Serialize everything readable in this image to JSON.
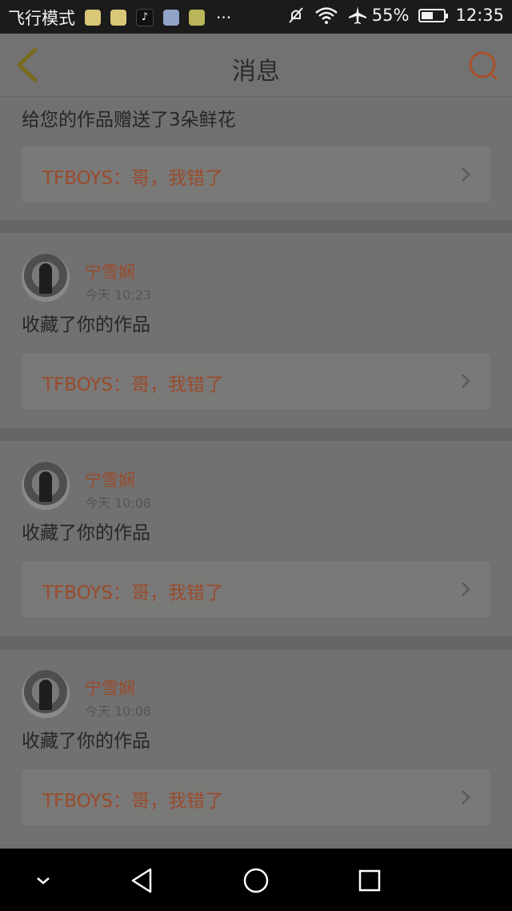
{
  "status_bar": {
    "mode": "飞行模式",
    "dots": "···",
    "battery": "55%",
    "battery_fraction": 0.55,
    "time": "12:35",
    "app_icons": [
      "qq-icon",
      "qq-icon",
      "tiktok-icon",
      "photo-app-icon",
      "medal-app-icon"
    ]
  },
  "header": {
    "title": "消息"
  },
  "feed": {
    "first_action": "给您的作品赠送了3朵鲜花",
    "work_title": "TFBOYS：哥，我错了",
    "items": [
      {
        "name": "宁雪娴",
        "time": "今天 10:23",
        "action": "收藏了你的作品",
        "work": "TFBOYS：哥，我错了"
      },
      {
        "name": "宁雪娴",
        "time": "今天 10:08",
        "action": "收藏了你的作品",
        "work": "TFBOYS：哥，我错了"
      },
      {
        "name": "宁雪娴",
        "time": "今天 10:08",
        "action": "收藏了你的作品",
        "work": "TFBOYS：哥，我错了"
      }
    ]
  },
  "colors": {
    "accent": "#9a4b2c",
    "back_icon": "#7a6a1e",
    "search_icon": "#a9502a"
  }
}
